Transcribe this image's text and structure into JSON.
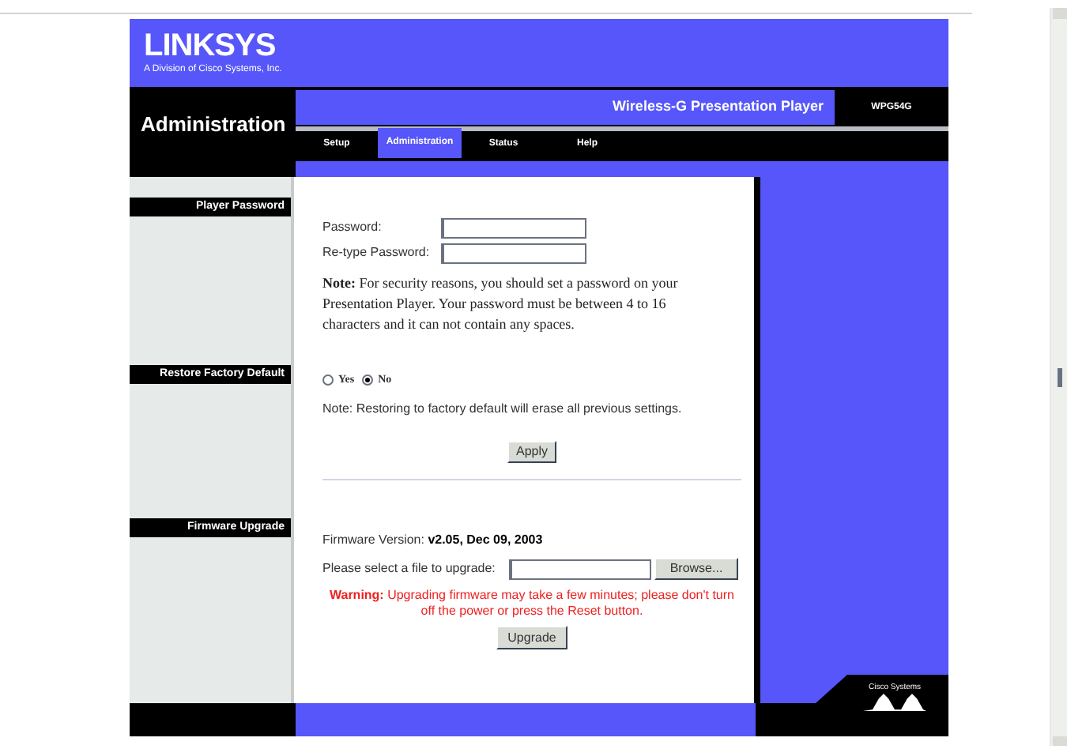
{
  "brand": {
    "name": "LINKSYS",
    "tagline": "A Division of Cisco Systems, Inc."
  },
  "page_title": "Administration",
  "product": {
    "name": "Wireless-G Presentation Player",
    "model": "WPG54G"
  },
  "tabs": [
    {
      "label": "Setup",
      "selected": false
    },
    {
      "label": "Administration",
      "selected": true
    },
    {
      "label": "Status",
      "selected": false
    },
    {
      "label": "Help",
      "selected": false
    }
  ],
  "sections": [
    {
      "kind": "password",
      "title": "Player Password",
      "fields": [
        {
          "label": "Password:"
        },
        {
          "label": "Re-type Password:"
        }
      ],
      "note_label": "Note:",
      "note": "For security reasons, you should set a password on your Presentation Player. Your password must be between 4 to 16 characters and it can not contain any spaces."
    },
    {
      "kind": "restore",
      "title": "Restore Factory Default",
      "options": [
        {
          "label": "Yes",
          "selected": false
        },
        {
          "label": "No",
          "selected": true
        }
      ],
      "note": "Note: Restoring to factory default will erase all previous settings.",
      "button": "Apply"
    },
    {
      "kind": "firmware",
      "title": "Firmware Upgrade",
      "version_label": "Firmware Version:",
      "version": "v2.05, Dec 09, 2003",
      "file_label": "Please select a file to upgrade:",
      "browse": "Browse...",
      "warning_label": "Warning:",
      "warning": "Upgrading firmware may take a few minutes; please don't turn off the power or press the Reset button.",
      "button": "Upgrade"
    }
  ],
  "footer_logo": "Cisco Systems"
}
